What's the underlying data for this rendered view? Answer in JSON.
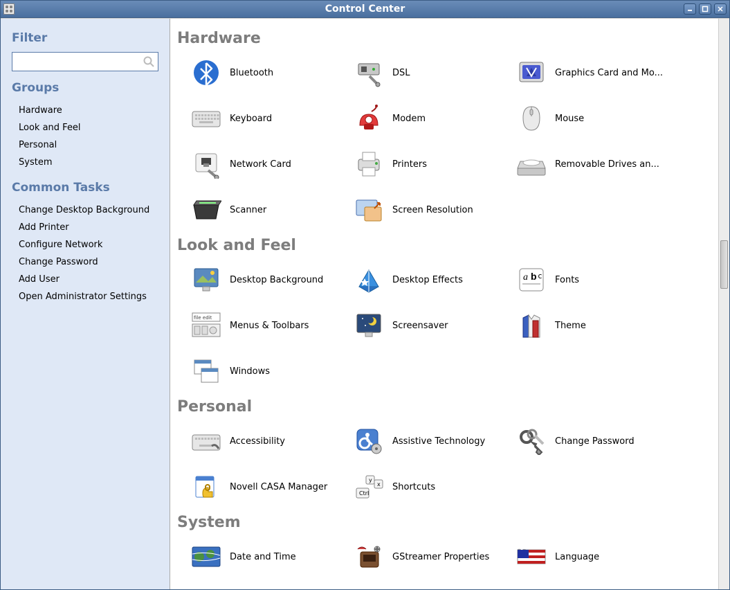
{
  "window": {
    "title": "Control Center"
  },
  "sidebar": {
    "filter_heading": "Filter",
    "groups_heading": "Groups",
    "groups": [
      {
        "label": "Hardware"
      },
      {
        "label": "Look and Feel"
      },
      {
        "label": "Personal"
      },
      {
        "label": "System"
      }
    ],
    "common_tasks_heading": "Common Tasks",
    "tasks": [
      {
        "label": "Change Desktop Background"
      },
      {
        "label": "Add Printer"
      },
      {
        "label": "Configure Network"
      },
      {
        "label": "Change Password"
      },
      {
        "label": "Add User"
      },
      {
        "label": "Open Administrator Settings"
      }
    ],
    "search_value": ""
  },
  "sections": [
    {
      "title": "Hardware",
      "items": [
        {
          "label": "Bluetooth",
          "icon": "bluetooth-icon"
        },
        {
          "label": "DSL",
          "icon": "dsl-icon"
        },
        {
          "label": "Graphics Card and Mo...",
          "icon": "graphics-card-icon"
        },
        {
          "label": "Keyboard",
          "icon": "keyboard-icon"
        },
        {
          "label": "Modem",
          "icon": "modem-icon"
        },
        {
          "label": "Mouse",
          "icon": "mouse-icon"
        },
        {
          "label": "Network Card",
          "icon": "network-card-icon"
        },
        {
          "label": "Printers",
          "icon": "printers-icon"
        },
        {
          "label": "Removable Drives an...",
          "icon": "removable-drives-icon"
        },
        {
          "label": "Scanner",
          "icon": "scanner-icon"
        },
        {
          "label": "Screen Resolution",
          "icon": "screen-resolution-icon"
        }
      ]
    },
    {
      "title": "Look and Feel",
      "items": [
        {
          "label": "Desktop Background",
          "icon": "desktop-background-icon"
        },
        {
          "label": "Desktop Effects",
          "icon": "desktop-effects-icon"
        },
        {
          "label": "Fonts",
          "icon": "fonts-icon"
        },
        {
          "label": "Menus & Toolbars",
          "icon": "menus-toolbars-icon"
        },
        {
          "label": "Screensaver",
          "icon": "screensaver-icon"
        },
        {
          "label": "Theme",
          "icon": "theme-icon"
        },
        {
          "label": "Windows",
          "icon": "windows-icon"
        }
      ]
    },
    {
      "title": "Personal",
      "items": [
        {
          "label": "Accessibility",
          "icon": "accessibility-icon"
        },
        {
          "label": "Assistive Technology",
          "icon": "assistive-tech-icon"
        },
        {
          "label": "Change Password",
          "icon": "change-password-icon"
        },
        {
          "label": "Novell CASA Manager",
          "icon": "casa-manager-icon"
        },
        {
          "label": "Shortcuts",
          "icon": "shortcuts-icon"
        }
      ]
    },
    {
      "title": "System",
      "items": [
        {
          "label": "Date and Time",
          "icon": "date-time-icon"
        },
        {
          "label": "GStreamer Properties",
          "icon": "gstreamer-icon"
        },
        {
          "label": "Language",
          "icon": "language-icon"
        }
      ]
    }
  ]
}
